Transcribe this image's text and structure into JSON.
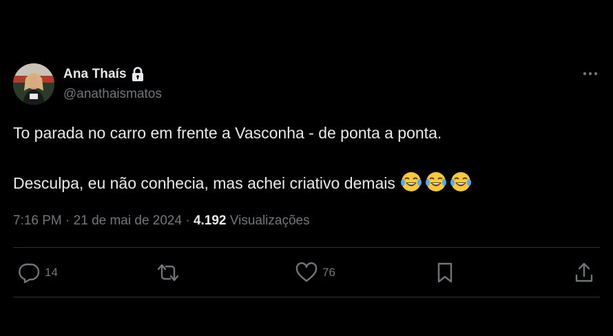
{
  "author": {
    "display_name": "Ana Thaís",
    "handle": "@anathaismatos",
    "protected": true
  },
  "tweet": {
    "line1": "To parada no carro em frente a Vasconha - de ponta a ponta.",
    "line2": "Desculpa, eu não conhecia, mas achei criativo demais",
    "emoji": "😂😂😂",
    "time": "7:16 PM",
    "separator": " · ",
    "date": "21 de mai de 2024",
    "views_count": "4.192",
    "views_label": "Visualizações"
  },
  "actions": {
    "reply_count": "14",
    "like_count": "76"
  },
  "icons": {
    "lock": "lock-icon",
    "more": "more-icon",
    "reply": "reply-icon",
    "retweet": "retweet-icon",
    "like": "heart-icon",
    "bookmark": "bookmark-icon",
    "share": "share-icon"
  },
  "colors": {
    "background": "#000000",
    "text": "#e7e9ea",
    "secondary": "#71767b",
    "divider": "#2f3336"
  }
}
